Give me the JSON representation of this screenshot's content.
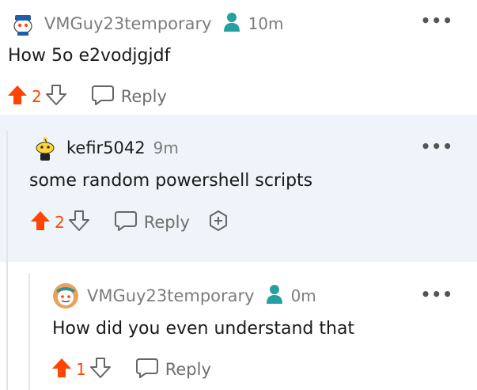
{
  "comments": [
    {
      "username": "VMGuy23temporary",
      "time": "10m",
      "body": "How 5o e2vodjgjdf",
      "votes": "2",
      "reply_label": "Reply",
      "more": "•••"
    },
    {
      "username": "kefir5042",
      "time": "9m",
      "body": "some random powershell scripts",
      "votes": "2",
      "reply_label": "Reply",
      "more": "•••"
    },
    {
      "username": "VMGuy23temporary",
      "time": "0m",
      "body": "How did you even understand that",
      "votes": "1",
      "reply_label": "Reply",
      "more": "•••"
    }
  ],
  "colors": {
    "upvote": "#ff4500",
    "op_badge": "#24a0a0",
    "highlight_bg": "#eef4f9"
  }
}
